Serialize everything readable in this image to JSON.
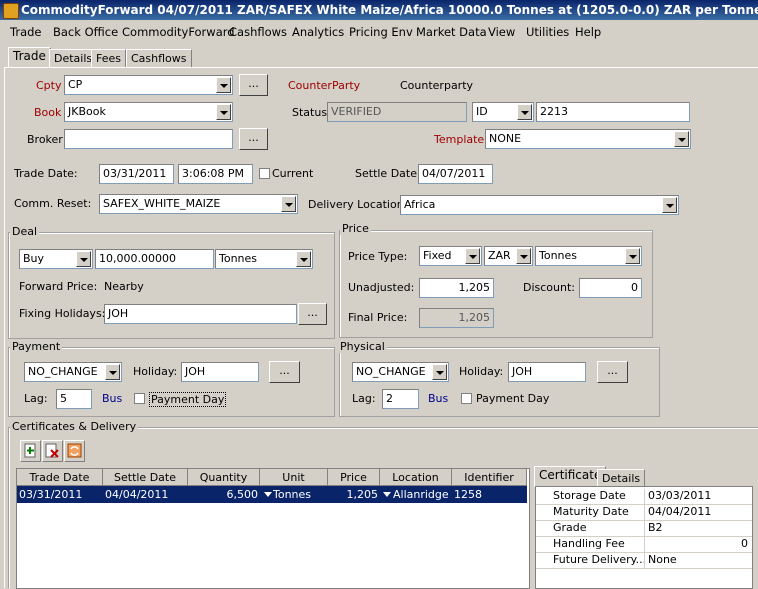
{
  "window": {
    "title": "CommodityForward 04/07/2011 ZAR/SAFEX White Maize/Africa 10000.0 Tonnes at (1205.0-0.0) ZAR  per Tonnes  -PO is Default Pro"
  },
  "menu": [
    "Trade",
    "Back Office",
    "CommodityForward",
    "Cashflows",
    "Analytics",
    "Pricing Env",
    "Market Data",
    "View",
    "Utilities",
    "Help"
  ],
  "tabs": [
    "Trade",
    "Details",
    "Fees",
    "Cashflows"
  ],
  "trade": {
    "cpty_label": "Cpty",
    "cpty_value": "CP",
    "counterparty_label": "CounterParty",
    "counterparty_value": "Counterparty",
    "book_label": "Book",
    "book_value": "JKBook",
    "status_label": "Status",
    "status_value": "VERIFIED",
    "id_type": "ID",
    "id_value": "2213",
    "broker_label": "Broker",
    "broker_value": "",
    "template_label": "Template",
    "template_value": "NONE",
    "trade_date_label": "Trade Date:",
    "trade_date": "03/31/2011",
    "trade_time": "3:06:08 PM",
    "current_label": "Current",
    "settle_date_label": "Settle Date:",
    "settle_date": "04/07/2011",
    "comm_reset_label": "Comm. Reset:",
    "comm_reset_value": "SAFEX_WHITE_MAIZE",
    "delivery_location_label": "Delivery Location:",
    "delivery_location_value": "Africa",
    "ellipsis": "..."
  },
  "deal": {
    "title": "Deal",
    "direction": "Buy",
    "quantity": "10,000.00000",
    "unit": "Tonnes",
    "forward_price_label": "Forward Price:",
    "forward_price_value": "Nearby",
    "fixing_holidays_label": "Fixing Holidays:",
    "fixing_holidays_value": "JOH"
  },
  "price": {
    "title": "Price",
    "price_type_label": "Price Type:",
    "price_type": "Fixed",
    "currency": "ZAR",
    "unit": "Tonnes",
    "unadjusted_label": "Unadjusted:",
    "unadjusted_value": "1,205",
    "discount_label": "Discount:",
    "discount_value": "0",
    "final_price_label": "Final Price:",
    "final_price_value": "1,205"
  },
  "payment": {
    "title": "Payment",
    "change": "NO_CHANGE",
    "holiday_label": "Holiday:",
    "holiday_value": "JOH",
    "lag_label": "Lag:",
    "lag_value": "5",
    "bus_label": "Bus",
    "payment_day_label": "Payment Day"
  },
  "physical": {
    "title": "Physical",
    "change": "NO_CHANGE",
    "holiday_label": "Holiday:",
    "holiday_value": "JOH",
    "lag_label": "Lag:",
    "lag_value": "2",
    "bus_label": "Bus",
    "payment_day_label": "Payment Day"
  },
  "certificates": {
    "title": "Certificates & Delivery",
    "columns": [
      "Trade Date",
      "Settle Date",
      "Quantity",
      "Unit",
      "Price",
      "Location",
      "Identifier"
    ],
    "rows": [
      {
        "trade_date": "03/31/2011",
        "settle_date": "04/04/2011",
        "quantity": "6,500",
        "unit": "Tonnes",
        "price": "1,205",
        "location": "Allanridge",
        "identifier": "1258"
      }
    ],
    "side_tabs": [
      "Certificate",
      "Details"
    ],
    "properties": [
      {
        "key": "Storage Date",
        "value": "03/03/2011"
      },
      {
        "key": "Maturity Date",
        "value": "04/04/2011"
      },
      {
        "key": "Grade",
        "value": "B2"
      },
      {
        "key": "Handling Fee",
        "value": "0"
      },
      {
        "key": "Future Delivery...",
        "value": "None"
      }
    ]
  },
  "colors": {
    "title_bar": "#0a246a",
    "selected_row": "#0a246a",
    "label_red": "#a00000",
    "label_blue": "#00008b"
  }
}
